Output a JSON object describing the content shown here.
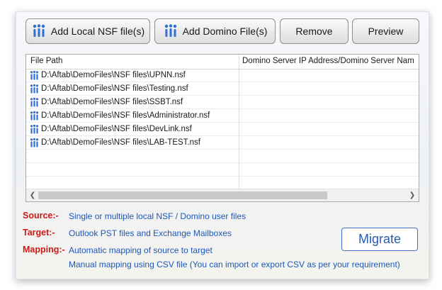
{
  "toolbar": {
    "add_local_label": "Add Local NSF file(s)",
    "add_domino_label": "Add Domino File(s)",
    "remove_label": "Remove",
    "preview_label": "Preview"
  },
  "grid": {
    "columns": [
      "File Path",
      "Domino Server IP Address/Domino Server Nam"
    ],
    "rows": [
      {
        "path": "D:\\Aftab\\DemoFiles\\NSF files\\UPNN.nsf",
        "server": ""
      },
      {
        "path": "D:\\Aftab\\DemoFiles\\NSF files\\Testing.nsf",
        "server": ""
      },
      {
        "path": "D:\\Aftab\\DemoFiles\\NSF files\\SSBT.nsf",
        "server": ""
      },
      {
        "path": "D:\\Aftab\\DemoFiles\\NSF files\\Administrator.nsf",
        "server": ""
      },
      {
        "path": "D:\\Aftab\\DemoFiles\\NSF files\\DevLink.nsf",
        "server": ""
      },
      {
        "path": "D:\\Aftab\\DemoFiles\\NSF files\\LAB-TEST.nsf",
        "server": ""
      }
    ],
    "empty_rows": 3,
    "row_icon": "lotus-notes-file-icon"
  },
  "info": {
    "source_label": "Source:-",
    "source_value": "Single or multiple local NSF / Domino user files",
    "target_label": "Target:-",
    "target_value": "Outlook PST files and Exchange Mailboxes",
    "mapping_label": "Mapping:-",
    "mapping_value1": "Automatic mapping of source to target",
    "mapping_value2": "Manual mapping using CSV file (You can import or export CSV as per your requirement)"
  },
  "migrate_label": "Migrate",
  "colors": {
    "label_red": "#d01818",
    "value_blue": "#1f57b8",
    "migrate_blue": "#2b5bb0",
    "icon_blue": "#2f6fd6"
  }
}
